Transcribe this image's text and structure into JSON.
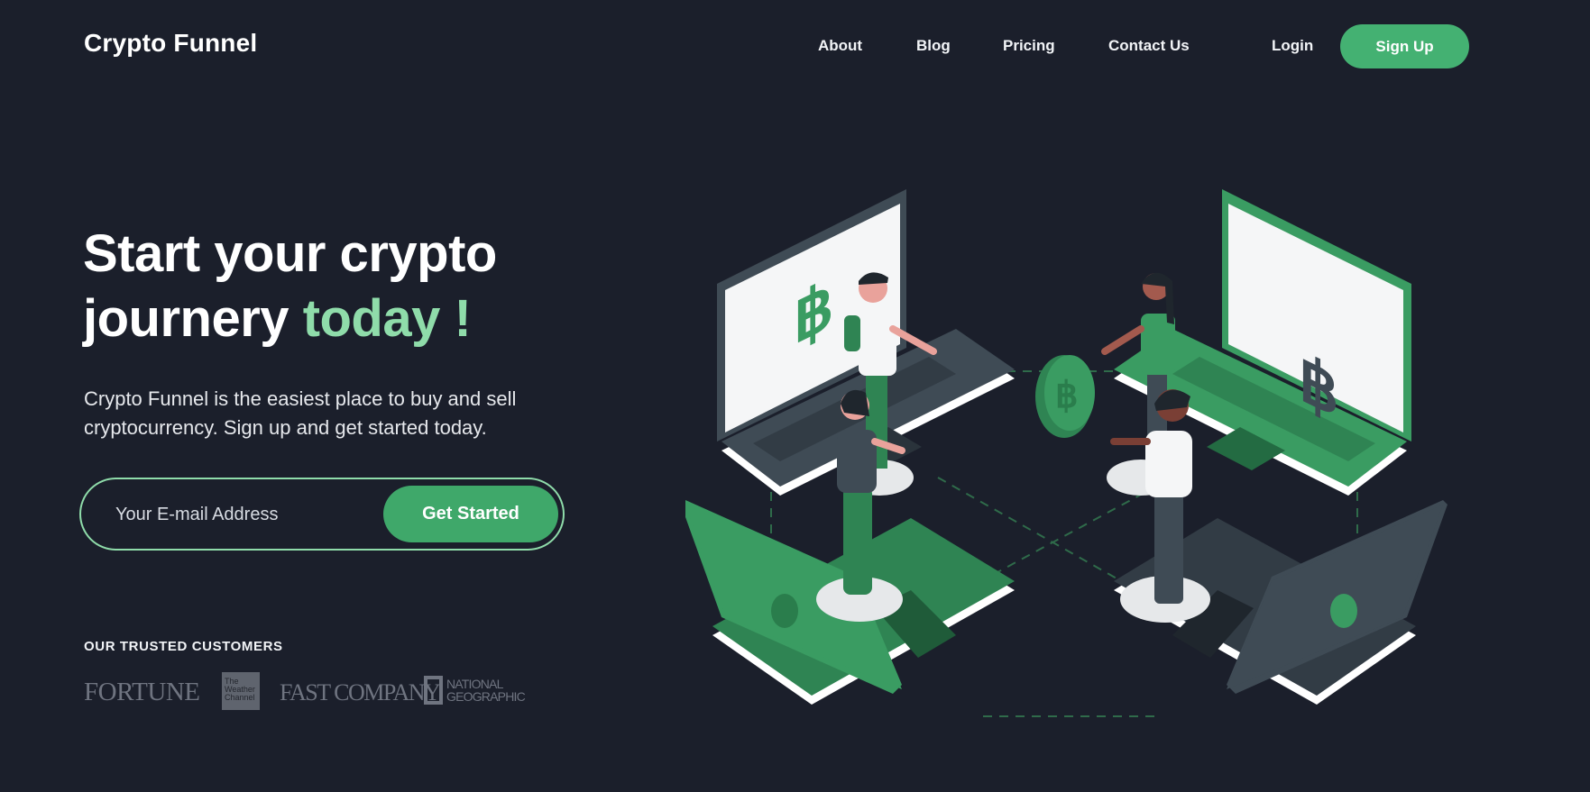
{
  "header": {
    "brand": "Crypto Funnel",
    "nav": [
      "About",
      "Blog",
      "Pricing",
      "Contact Us"
    ],
    "login": "Login",
    "signup": "Sign Up"
  },
  "hero": {
    "title_line1": "Start your crypto",
    "title_line2": "journery",
    "title_accent": "today !",
    "subtitle": "Crypto Funnel is the easiest place to buy and sell cryptocurrency. Sign up and get started today.",
    "email_placeholder": "Your E-mail Address",
    "cta": "Get Started"
  },
  "trusted": {
    "heading": "OUR TRUSTED CUSTOMERS",
    "logos": {
      "fortune": "FORTUNE",
      "weather": "The Weather Channel",
      "fastcompany": "FAST COMPANY",
      "natgeo": "NATIONAL GEOGRAPHIC"
    }
  },
  "colors": {
    "background": "#1b1f2b",
    "accent": "#44b172",
    "accent_light": "#8fdcaa",
    "laptop_dark": "#3f4b55",
    "laptop_green": "#3a9c62"
  },
  "icons": {
    "illustration": "crypto-trading-illustration",
    "coin": "bitcoin-coin-icon"
  }
}
